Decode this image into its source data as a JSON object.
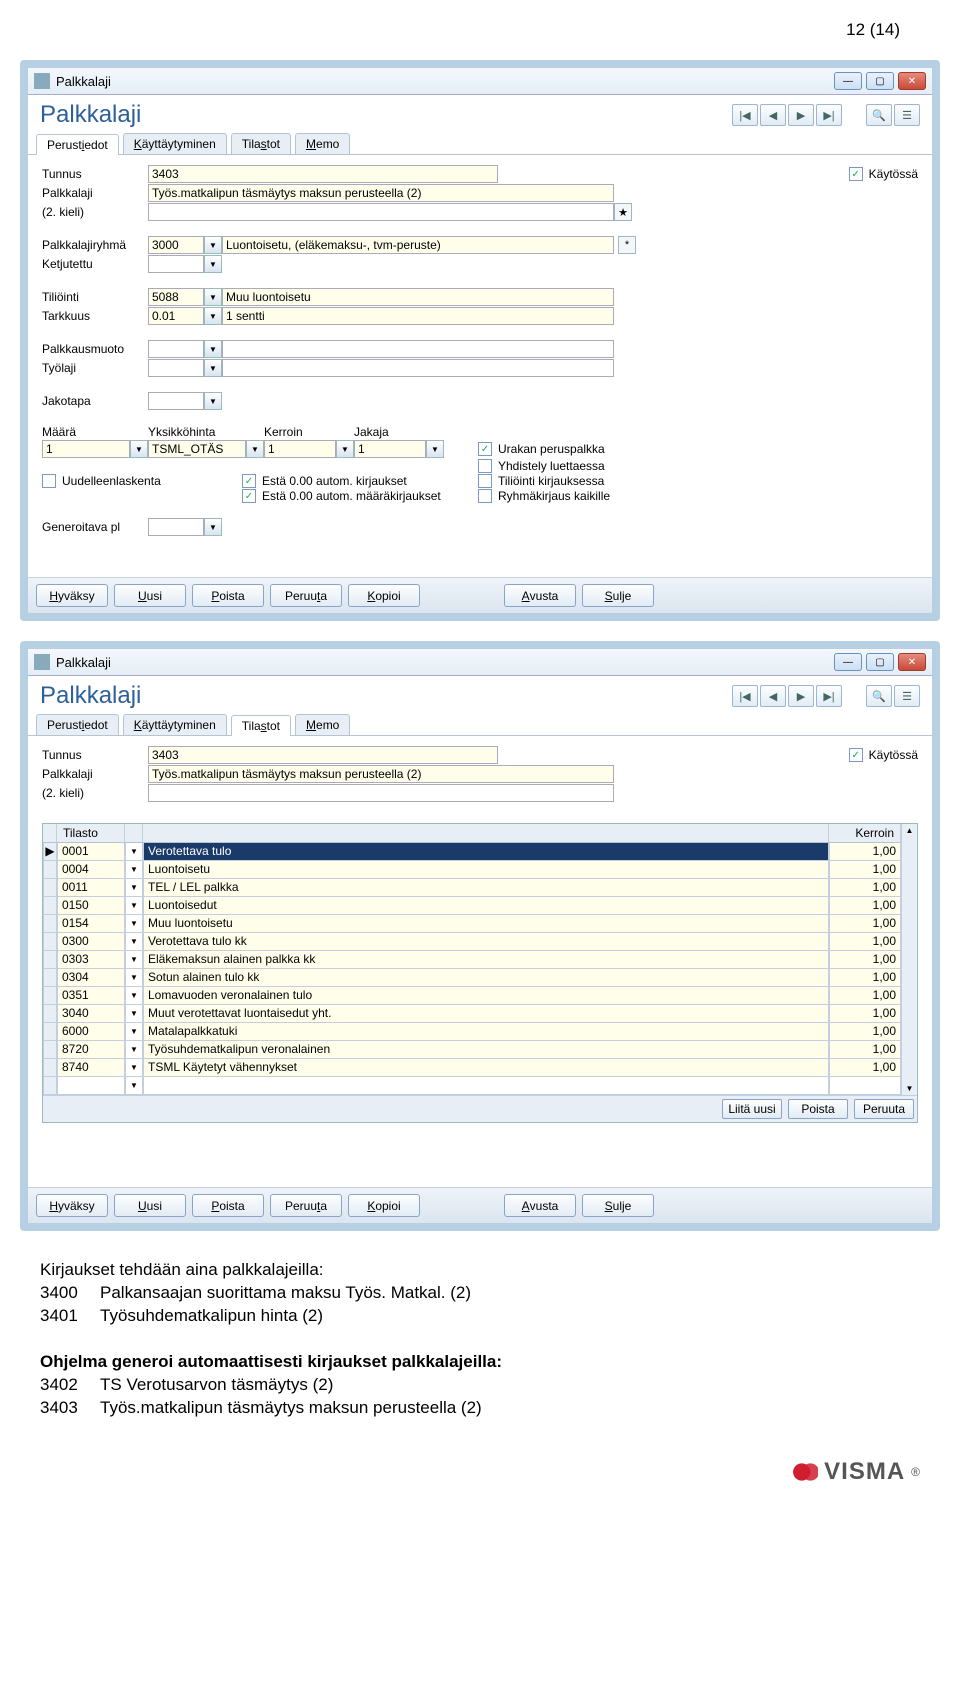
{
  "page_number": "12 (14)",
  "windows": [
    {
      "title": "Palkkalaji",
      "heading": "Palkkalaji",
      "tabs": [
        {
          "label": "Perustiedot",
          "hotkey_index": 6,
          "active": true
        },
        {
          "label": "Käyttäytyminen",
          "hotkey_index": 0,
          "active": false
        },
        {
          "label": "Tilastot",
          "hotkey_index": 4,
          "active": false
        },
        {
          "label": "Memo",
          "hotkey_index": 0,
          "active": false
        }
      ],
      "active_tab": 0,
      "buttons": [
        {
          "label": "Hyväksy",
          "u": 0
        },
        {
          "label": "Uusi",
          "u": 0
        },
        {
          "label": "Poista",
          "u": 0
        },
        {
          "label": "Peruuta",
          "u": 5
        },
        {
          "label": "Kopioi",
          "u": 0
        },
        {
          "gap": true
        },
        {
          "label": "Avusta",
          "u": 0
        },
        {
          "label": "Sulje",
          "u": 0
        }
      ],
      "form": {
        "tunnus_label": "Tunnus",
        "tunnus": "3403",
        "kaytossa_label": "Käytössä",
        "kaytossa": true,
        "palkkalaji_label": "Palkkalaji",
        "palkkalaji": "Työs.matkalipun täsmäytys maksun perusteella (2)",
        "kieli_label": "(2. kieli)",
        "kieli": "",
        "plryhma_label": "Palkkalajiryhmä",
        "plryhma_code": "3000",
        "plryhma_text": "Luontoisetu, (eläkemaksu-, tvm-peruste)",
        "ketjutettu_label": "Ketjutettu",
        "ketjutettu": "",
        "tiliointi_label": "Tiliöinti",
        "tiliointi_code": "5088",
        "tiliointi_text": "Muu luontoisetu",
        "tarkkuus_label": "Tarkkuus",
        "tarkkuus_code": "0.01",
        "tarkkuus_text": "1 sentti",
        "palkkausmuoto_label": "Palkkausmuoto",
        "palkkausmuoto": "",
        "tyolaji_label": "Työlaji",
        "tyolaji": "",
        "jakotapa_label": "Jakotapa",
        "jakotapa": "",
        "col_maara": "Määrä",
        "col_yksikko": "Yksikköhinta",
        "col_kerroin": "Kerroin",
        "col_jakaja": "Jakaja",
        "maara": "1",
        "yksikko": "TSML_OTÄS",
        "kerroin": "1",
        "jakaja": "1",
        "uudelleen_label": "Uudelleenlaskenta",
        "uudelleen": false,
        "esta_kirj_label": "Estä 0.00 autom. kirjaukset",
        "esta_kirj": true,
        "esta_maara_label": "Estä 0.00 autom. määräkirjaukset",
        "esta_maara": true,
        "urakan_label": "Urakan peruspalkka",
        "urakan": true,
        "yhdistely_label": "Yhdistely luettaessa",
        "yhdistely": false,
        "tiliointi_kirj_label": "Tiliöinti kirjauksessa",
        "tiliointi_kirj": false,
        "ryhma_label": "Ryhmäkirjaus kaikille",
        "ryhma": false,
        "generoitava_label": "Generoitava pl",
        "generoitava": ""
      }
    },
    {
      "title": "Palkkalaji",
      "heading": "Palkkalaji",
      "tabs": [
        {
          "label": "Perustiedot",
          "hotkey_index": 6,
          "active": false
        },
        {
          "label": "Käyttäytyminen",
          "hotkey_index": 0,
          "active": false
        },
        {
          "label": "Tilastot",
          "hotkey_index": 4,
          "active": true
        },
        {
          "label": "Memo",
          "hotkey_index": 0,
          "active": false
        }
      ],
      "active_tab": 2,
      "buttons": [
        {
          "label": "Hyväksy",
          "u": 0
        },
        {
          "label": "Uusi",
          "u": 0
        },
        {
          "label": "Poista",
          "u": 0
        },
        {
          "label": "Peruuta",
          "u": 5
        },
        {
          "label": "Kopioi",
          "u": 0
        },
        {
          "gap": true
        },
        {
          "label": "Avusta",
          "u": 0
        },
        {
          "label": "Sulje",
          "u": 0
        }
      ],
      "form": {
        "tunnus_label": "Tunnus",
        "tunnus": "3403",
        "kaytossa_label": "Käytössä",
        "kaytossa": true,
        "palkkalaji_label": "Palkkalaji",
        "palkkalaji": "Työs.matkalipun täsmäytys maksun perusteella (2)",
        "kieli_label": "(2. kieli)",
        "kieli": ""
      },
      "grid": {
        "col_tilasto": "Tilasto",
        "col_kerroin": "Kerroin",
        "rows": [
          {
            "code": "0001",
            "name": "Verotettava tulo",
            "kerroin": "1,00",
            "selected": true
          },
          {
            "code": "0004",
            "name": "Luontoisetu",
            "kerroin": "1,00"
          },
          {
            "code": "0011",
            "name": "TEL / LEL palkka",
            "kerroin": "1,00"
          },
          {
            "code": "0150",
            "name": "Luontoisedut",
            "kerroin": "1,00"
          },
          {
            "code": "0154",
            "name": "Muu luontoisetu",
            "kerroin": "1,00"
          },
          {
            "code": "0300",
            "name": "Verotettava tulo kk",
            "kerroin": "1,00"
          },
          {
            "code": "0303",
            "name": "Eläkemaksun alainen palkka kk",
            "kerroin": "1,00"
          },
          {
            "code": "0304",
            "name": "Sotun alainen tulo kk",
            "kerroin": "1,00"
          },
          {
            "code": "0351",
            "name": "Lomavuoden veronalainen tulo",
            "kerroin": "1,00"
          },
          {
            "code": "3040",
            "name": "Muut verotettavat luontaisedut yht.",
            "kerroin": "1,00"
          },
          {
            "code": "6000",
            "name": "Matalapalkkatuki",
            "kerroin": "1,00"
          },
          {
            "code": "8720",
            "name": "Työsuhdematkalipun veronalainen",
            "kerroin": "1,00"
          },
          {
            "code": "8740",
            "name": "TSML Käytetyt vähennykset",
            "kerroin": "1,00"
          }
        ],
        "btn_liita": "Liitä uusi",
        "btn_poista": "Poista",
        "btn_peruuta": "Peruuta"
      }
    }
  ],
  "body": {
    "intro": "Kirjaukset tehdään aina palkkalajeilla:",
    "lines1": [
      {
        "code": "3400",
        "text": "Palkansaajan suorittama maksu Työs. Matkal. (2)"
      },
      {
        "code": "3401",
        "text": "Työsuhdematkalipun hinta (2)"
      }
    ],
    "gen": "Ohjelma generoi automaattisesti kirjaukset palkkalajeilla:",
    "lines2": [
      {
        "code": "3402",
        "text": "TS Verotusarvon täsmäytys (2)"
      },
      {
        "code": "3403",
        "text": "Työs.matkalipun täsmäytys maksun perusteella (2)"
      }
    ]
  },
  "logo_text": "VISMA"
}
